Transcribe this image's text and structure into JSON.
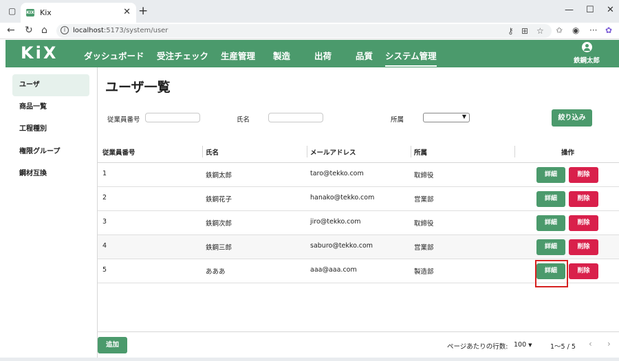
{
  "browser": {
    "tab_title": "Kix",
    "favicon_text": "KIX",
    "url_host": "localhost",
    "url_path": ":5173/system/user"
  },
  "app": {
    "logo": "KiX",
    "menu": [
      "ダッシュボード",
      "受注チェック",
      "生産管理",
      "製造",
      "出荷",
      "品質",
      "システム管理"
    ],
    "active_menu": "システム管理",
    "user_name": "鉄鋼太郎",
    "accent_color": "#4b9a6c",
    "danger_color": "#d9204b"
  },
  "sidebar": {
    "items": [
      {
        "label": "ユーザ",
        "active": true
      },
      {
        "label": "商品一覧"
      },
      {
        "label": "工程種別"
      },
      {
        "label": "権限グループ"
      },
      {
        "label": "鋼材互換"
      }
    ]
  },
  "main": {
    "title": "ユーザ一覧",
    "filter": {
      "employee_no_label": "従業員番号",
      "employee_no_value": "",
      "name_label": "氏名",
      "name_value": "",
      "dept_label": "所属",
      "dept_value": "",
      "filter_button": "絞り込み"
    },
    "table": {
      "headers": [
        "従業員番号",
        "氏名",
        "メールアドレス",
        "所属",
        "操作"
      ],
      "rows": [
        {
          "id": "1",
          "name": "鉄鋼太郎",
          "email": "taro@tekko.com",
          "dept": "取締役"
        },
        {
          "id": "2",
          "name": "鉄鋼花子",
          "email": "hanako@tekko.com",
          "dept": "営業部"
        },
        {
          "id": "3",
          "name": "鉄鋼次郎",
          "email": "jiro@tekko.com",
          "dept": "取締役"
        },
        {
          "id": "4",
          "name": "鉄鋼三郎",
          "email": "saburo@tekko.com",
          "dept": "営業部"
        },
        {
          "id": "5",
          "name": "あああ",
          "email": "aaa@aaa.com",
          "dept": "製造部"
        }
      ],
      "detail_label": "詳細",
      "delete_label": "削除"
    },
    "footer": {
      "add_button": "追加",
      "rows_per_page_label": "ページあたりの行数:",
      "rows_per_page_value": "100",
      "range_text": "1〜5 / 5"
    }
  }
}
